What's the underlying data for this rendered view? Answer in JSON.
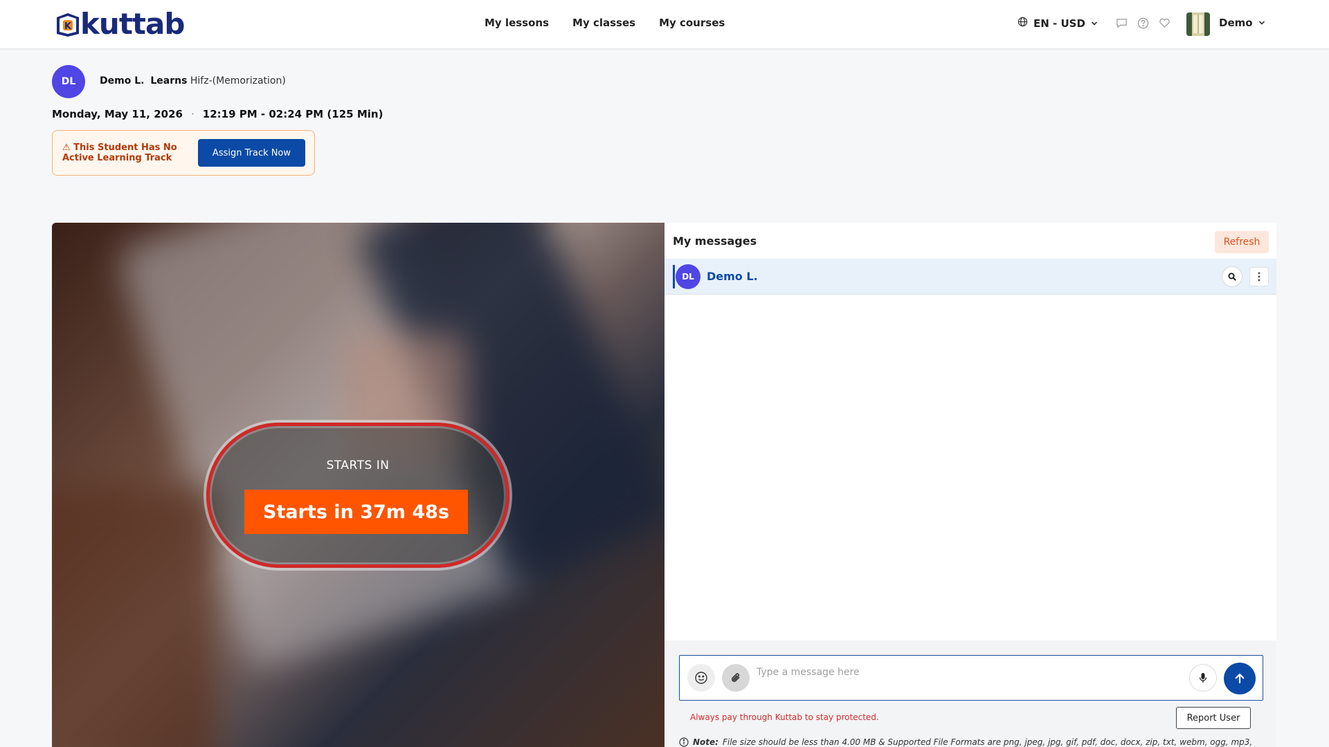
{
  "header": {
    "logo_text": "kuttab",
    "nav": [
      "My lessons",
      "My classes",
      "My courses"
    ],
    "language": "EN - USD",
    "user_name": "Demo"
  },
  "student": {
    "initials": "DL",
    "name": "Demo L.",
    "learns_label": "Learns",
    "subject": "Hifz-(Memorization)",
    "date": "Monday, May 11, 2026",
    "separator": "·",
    "time": "12:19 PM - 02:24 PM (125 Min)"
  },
  "warning": {
    "text": "⚠ This Student Has No Active Learning Track",
    "button": "Assign Track Now"
  },
  "video": {
    "starts_label": "STARTS IN",
    "countdown": "Starts in 37m 48s"
  },
  "messages": {
    "title": "My messages",
    "refresh": "Refresh",
    "contact": {
      "initials": "DL",
      "name": "Demo L."
    },
    "input_placeholder": "Type a message here",
    "pay_warning": "Always pay through Kuttab to stay protected.",
    "report_button": "Report User",
    "note_label": "Note:",
    "note_text": "File size should be less than 4.00 MB & Supported File Formats are png, jpeg, jpg, gif, pdf, doc, docx, zip, txt, webm, ogg, mp3,"
  },
  "colors": {
    "brand_blue": "#0b4aa6",
    "avatar_purple": "#4f46e5",
    "countdown_orange": "#ff5500",
    "alert_red": "#d42b2b"
  },
  "icons": [
    "globe-icon",
    "chevron-down-icon",
    "chat-icon",
    "help-icon",
    "heart-icon",
    "search-user-icon",
    "kebab-icon",
    "emoji-icon",
    "paperclip-icon",
    "mic-icon",
    "send-arrow-icon",
    "info-icon"
  ]
}
